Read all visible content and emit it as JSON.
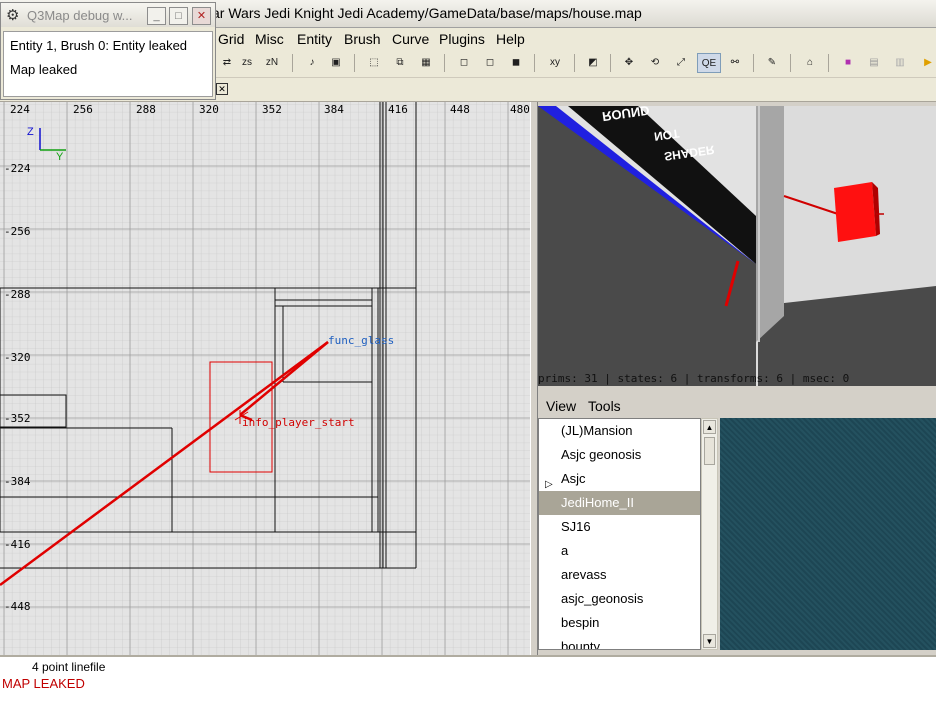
{
  "window": {
    "title": "ar Wars Jedi Knight Jedi Academy/GameData/base/maps/house.map"
  },
  "menubar": [
    "Grid",
    "Misc",
    "Entity",
    "Brush",
    "Curve",
    "Plugins",
    "Help"
  ],
  "toolbar": {
    "buttons": [
      "x-y",
      "zs",
      "zN",
      "note",
      "save",
      "sel1",
      "sel2",
      "sel3",
      "cube1",
      "cube2",
      "cube3",
      "xyz",
      "img1",
      "move",
      "rotate",
      "scale",
      "QE",
      "vertex",
      "paint",
      "house",
      "cube",
      "doc",
      "doc2",
      "arrow"
    ],
    "qe_label": "QE"
  },
  "view2d": {
    "x_ticks": [
      "224",
      "256",
      "288",
      "320",
      "352",
      "384",
      "416",
      "448",
      "480"
    ],
    "y_ticks": [
      "-224",
      "-256",
      "-288",
      "-320",
      "-352",
      "-384",
      "-416",
      "-448"
    ],
    "axis_z": "Z",
    "axis_y": "Y",
    "entity_func_glass": "func_glass",
    "entity_player_start": "info_player_start"
  },
  "view3d": {
    "status": "prims: 31 | states: 6 | transforms: 6 | msec: 0",
    "shader_text": [
      "ROUND",
      "NOT",
      "SHADER"
    ]
  },
  "texture_panel": {
    "menu": [
      "View",
      "Tools"
    ],
    "items": [
      "(JL)Mansion",
      "Asjc geonosis",
      "Asjc",
      "JediHome_II",
      "SJ16",
      "a",
      "arevass",
      "asjc_geonosis",
      "bespin",
      "bounty"
    ],
    "selected_index": 3,
    "expandable_index": 2
  },
  "console": {
    "line1": "4 point linefile",
    "line2": "MAP LEAKED"
  },
  "debug_window": {
    "title": "Q3Map debug w...",
    "messages": [
      "Entity 1, Brush 0: Entity leaked",
      "Map leaked"
    ]
  }
}
